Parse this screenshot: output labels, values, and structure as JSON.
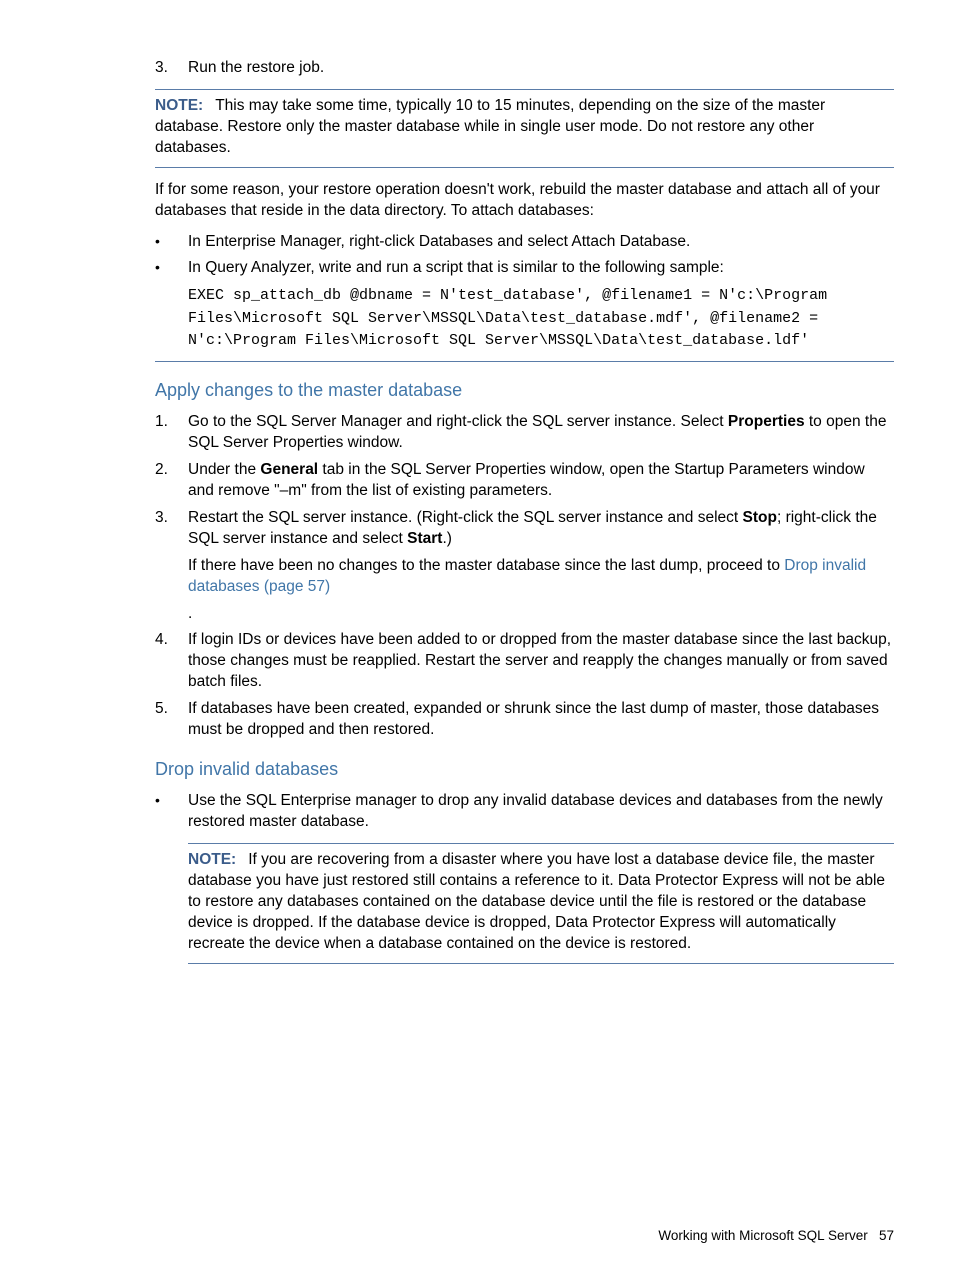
{
  "top_step": {
    "num": "3.",
    "text": "Run the restore job."
  },
  "note1": {
    "label": "NOTE:",
    "text": "This may take some time, typically 10 to 15 minutes, depending on the size of the master database. Restore only the master database while in single user mode. Do not restore any other databases."
  },
  "para_rebuild": "If for some reason, your restore operation doesn't work, rebuild the master database and attach all of your databases that reside in the data directory. To attach databases:",
  "bullets": {
    "b1": "In Enterprise Manager, right-click Databases and select Attach Database.",
    "b2": "In Query Analyzer, write and run a script that is similar to the following sample:",
    "code": "EXEC sp_attach_db @dbname = N'test_database', @filename1 = N'c:\\Program Files\\Microsoft SQL Server\\MSSQL\\Data\\test_database.mdf', @filename2 = N'c:\\Program Files\\Microsoft SQL Server\\MSSQL\\Data\\test_database.ldf'"
  },
  "heading_apply": "Apply changes to the master database",
  "apply_steps": {
    "s1": {
      "num": "1.",
      "pre": "Go to the SQL Server Manager and right-click the SQL server instance. Select ",
      "bold": "Properties",
      "post": " to open the SQL Server Properties window."
    },
    "s2": {
      "num": "2.",
      "pre": "Under the ",
      "bold": "General",
      "post": " tab in the SQL Server Properties window, open the Startup Parameters window and remove \"–m\" from the list of existing parameters."
    },
    "s3": {
      "num": "3.",
      "pre": "Restart the SQL server instance. (Right-click the SQL server instance and select ",
      "bold1": "Stop",
      "mid": "; right-click the SQL server instance and select ",
      "bold2": "Start",
      "post": ".)",
      "after_pre": "If there have been no changes to the master database since the last dump, proceed to ",
      "link": "Drop invalid databases (page 57)"
    },
    "s4": {
      "num": "4.",
      "text": "If login IDs or devices have been added to or dropped from the master database since the last backup, those changes must be reapplied. Restart the server and reapply the changes manually or from saved batch files."
    },
    "s5": {
      "num": "5.",
      "text": "If databases have been created, expanded or shrunk since the last dump of master, those databases must be dropped and then restored."
    }
  },
  "heading_drop": "Drop invalid databases",
  "drop_bullet": "Use the SQL Enterprise manager to drop any invalid database devices and databases from the newly restored master database.",
  "note2": {
    "label": "NOTE:",
    "text": "If you are recovering from a disaster where you have lost a database device file, the master database you have just restored still contains a reference to it. Data Protector Express will not be able to restore any databases contained on the database device until the file is restored or the database device is dropped. If the database device is dropped, Data Protector Express will automatically recreate the device when a database contained on the device is restored."
  },
  "footer": {
    "text": "Working with Microsoft SQL Server",
    "page": "57"
  },
  "period": "."
}
